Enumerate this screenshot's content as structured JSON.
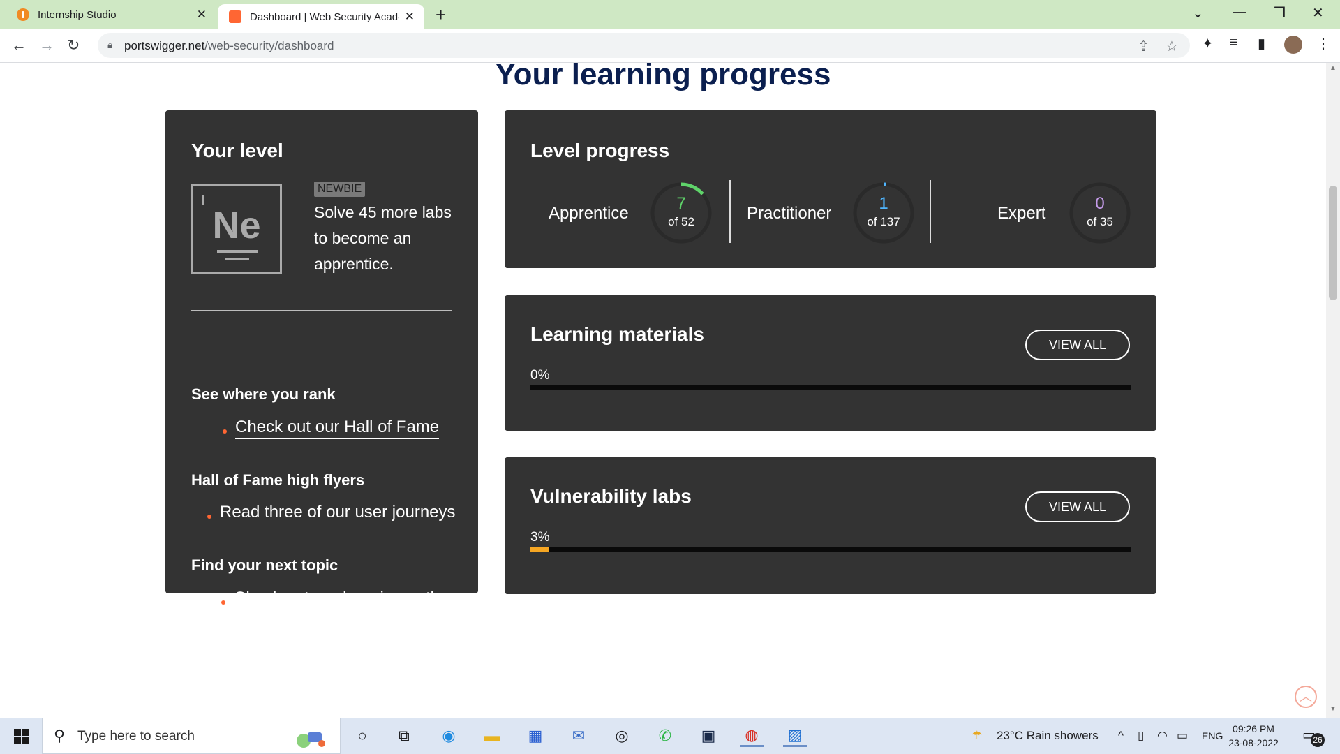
{
  "browser": {
    "tabs": [
      {
        "title": "Internship Studio"
      },
      {
        "title": "Dashboard | Web Security Acade"
      }
    ],
    "url_domain": "portswigger.net",
    "url_path": "/web-security/dashboard"
  },
  "page": {
    "title": "Your learning progress",
    "your_level": {
      "heading": "Your level",
      "element_symbol": "Ne",
      "badge": "NEWBIE",
      "description": "Solve 45 more labs to become an apprentice.",
      "sections": [
        {
          "heading": "See where you rank",
          "link": "Check out our Hall of Fame"
        },
        {
          "heading": "Hall of Fame high flyers",
          "link": "Read three of our user journeys"
        },
        {
          "heading": "Find your next topic",
          "link": "Check out our learning path"
        }
      ]
    },
    "level_progress": {
      "heading": "Level progress",
      "levels": [
        {
          "name": "Apprentice",
          "count": "7",
          "of": "of 52",
          "progress": 0.135,
          "color": "#5fd36a"
        },
        {
          "name": "Practitioner",
          "count": "1",
          "of": "of 137",
          "progress": 0.007,
          "color": "#4fb6ff"
        },
        {
          "name": "Expert",
          "count": "0",
          "of": "of 35",
          "progress": 0.0,
          "color": "#c49be8"
        }
      ]
    },
    "learning_materials": {
      "heading": "Learning materials",
      "button": "VIEW ALL",
      "percent_label": "0%",
      "progress": 0.0
    },
    "vulnerability_labs": {
      "heading": "Vulnerability labs",
      "button": "VIEW ALL",
      "percent_label": "3%",
      "progress": 0.03
    }
  },
  "taskbar": {
    "search_placeholder": "Type here to search",
    "weather": "23°C  Rain showers",
    "language": "ENG",
    "time": "09:26 PM",
    "date": "23-08-2022",
    "notifications": "26"
  },
  "colors": {
    "accent_orange": "#ff6633",
    "panel_bg": "#333333",
    "title_navy": "#0b1f4f",
    "progress_fill": "#f5a623"
  }
}
